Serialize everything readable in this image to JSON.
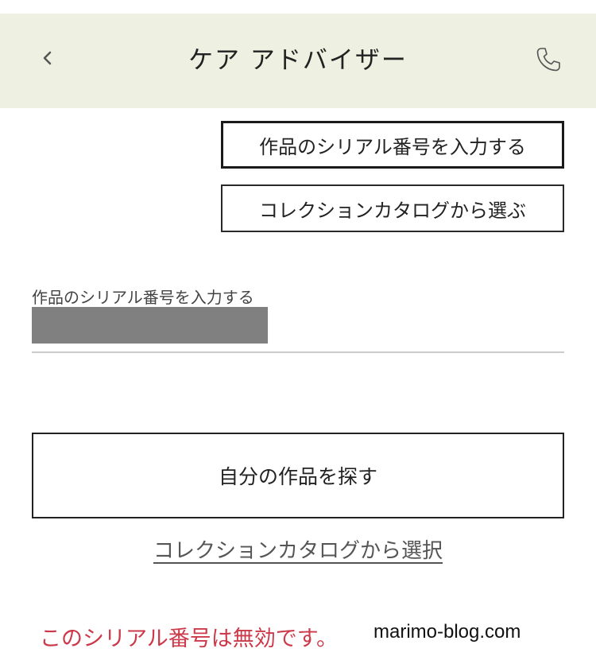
{
  "header": {
    "title": "ケア アドバイザー",
    "back_icon": "chevron-left-icon",
    "phone_icon": "phone-icon",
    "background_color": "#eef0e1"
  },
  "options": {
    "serial_label": "作品のシリアル番号を入力する",
    "serial_selected": true,
    "catalog_label": "コレクションカタログから選ぶ"
  },
  "serial_field": {
    "label": "作品のシリアル番号を入力する",
    "value": ""
  },
  "find_button": {
    "label": "自分の作品を探す"
  },
  "catalog_link": {
    "label": "コレクションカタログから選択"
  },
  "error": {
    "message": "このシリアル番号は無効です。",
    "color": "#cc3a4a"
  },
  "watermark": {
    "text": "marimo-blog.com"
  }
}
